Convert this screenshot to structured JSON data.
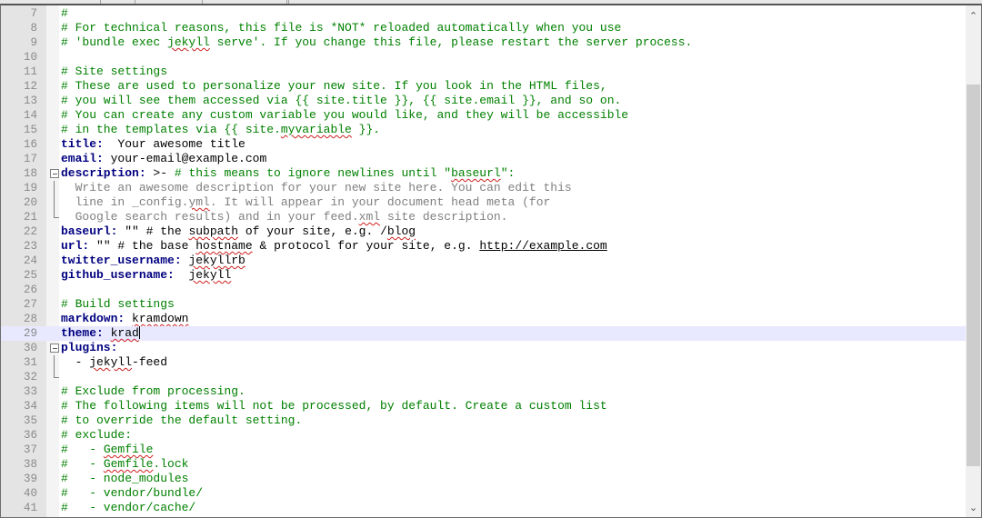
{
  "editor": {
    "current_line": 29,
    "colors": {
      "comment": "#008000",
      "key": "#000080",
      "folded_text": "#808080",
      "current_line_bg": "#e8e8ff",
      "misspelling": "#d02020"
    },
    "lines": [
      {
        "n": "7",
        "s": [
          [
            "c",
            "#"
          ]
        ]
      },
      {
        "n": "8",
        "s": [
          [
            "c",
            "# For technical reasons, this file is *NOT* reloaded automatically when you use"
          ]
        ]
      },
      {
        "n": "9",
        "s": [
          [
            "c",
            "# 'bundle exec "
          ],
          [
            "c sp",
            "jekyll"
          ],
          [
            "c",
            " serve'. If you change this file, please restart the server process."
          ]
        ]
      },
      {
        "n": "10",
        "s": []
      },
      {
        "n": "11",
        "s": [
          [
            "c",
            "# Site settings"
          ]
        ]
      },
      {
        "n": "12",
        "s": [
          [
            "c",
            "# These are used to personalize your new site. If you look in the HTML files,"
          ]
        ]
      },
      {
        "n": "13",
        "s": [
          [
            "c",
            "# you will see them accessed via {{ site.title }}, {{ site.email }}, and so on."
          ]
        ]
      },
      {
        "n": "14",
        "s": [
          [
            "c",
            "# You can create any custom variable you would like, and they will be accessible"
          ]
        ]
      },
      {
        "n": "15",
        "s": [
          [
            "c",
            "# in the templates via {{ site."
          ],
          [
            "c sp",
            "myvariable"
          ],
          [
            "c",
            " }}."
          ]
        ]
      },
      {
        "n": "16",
        "s": [
          [
            "k",
            "title:"
          ],
          [
            "",
            "  Your awesome title"
          ]
        ]
      },
      {
        "n": "17",
        "s": [
          [
            "k",
            "email:"
          ],
          [
            "",
            " your-email@example.com"
          ]
        ]
      },
      {
        "n": "18",
        "fold": "start",
        "s": [
          [
            "k",
            "description:"
          ],
          [
            "",
            " >- "
          ],
          [
            "c",
            "# this means to ignore newlines until \""
          ],
          [
            "c sp",
            "baseurl"
          ],
          [
            "c",
            "\":"
          ]
        ]
      },
      {
        "n": "19",
        "fold": "mid",
        "s": [
          [
            "g",
            "  Write an awesome description for your new site here. You can edit this"
          ]
        ]
      },
      {
        "n": "20",
        "fold": "mid",
        "s": [
          [
            "g",
            "  line in _config."
          ],
          [
            "g sp",
            "yml"
          ],
          [
            "g",
            ". It will appear in your document head meta (for"
          ]
        ]
      },
      {
        "n": "21",
        "fold": "end",
        "s": [
          [
            "g",
            "  Google search results) and in your feed."
          ],
          [
            "g sp",
            "xml"
          ],
          [
            "g",
            " site description."
          ]
        ]
      },
      {
        "n": "22",
        "s": [
          [
            "k",
            "baseurl:"
          ],
          [
            "",
            " \"\" # the "
          ],
          [
            "sp",
            "subpath"
          ],
          [
            "",
            " of your site, e.g. /"
          ],
          [
            "sp",
            "blog"
          ]
        ]
      },
      {
        "n": "23",
        "s": [
          [
            "k",
            "url:"
          ],
          [
            "",
            " \"\" # the base "
          ],
          [
            "sp",
            "hostname"
          ],
          [
            "",
            " & protocol for your site, e.g. "
          ],
          [
            "lnk",
            "http://example.com"
          ]
        ]
      },
      {
        "n": "24",
        "s": [
          [
            "k",
            "twitter_username:"
          ],
          [
            "",
            " "
          ],
          [
            "sp",
            "jekyllrb"
          ]
        ]
      },
      {
        "n": "25",
        "s": [
          [
            "k",
            "github_username:"
          ],
          [
            "",
            "  "
          ],
          [
            "sp",
            "jekyll"
          ]
        ]
      },
      {
        "n": "26",
        "s": []
      },
      {
        "n": "27",
        "s": [
          [
            "c",
            "# Build settings"
          ]
        ]
      },
      {
        "n": "28",
        "s": [
          [
            "k",
            "markdown:"
          ],
          [
            "",
            " "
          ],
          [
            "sp",
            "kramdown"
          ]
        ]
      },
      {
        "n": "29",
        "cur": true,
        "s": [
          [
            "k",
            "theme:"
          ],
          [
            "",
            " "
          ],
          [
            "sp",
            "krad"
          ]
        ]
      },
      {
        "n": "30",
        "fold": "start",
        "s": [
          [
            "k",
            "plugins:"
          ]
        ]
      },
      {
        "n": "31",
        "fold": "mid",
        "s": [
          [
            "",
            "  - "
          ],
          [
            "sp",
            "jekyll"
          ],
          [
            "",
            "-feed"
          ]
        ]
      },
      {
        "n": "32",
        "fold": "end",
        "s": []
      },
      {
        "n": "33",
        "s": [
          [
            "c",
            "# Exclude from processing."
          ]
        ]
      },
      {
        "n": "34",
        "s": [
          [
            "c",
            "# The following items will not be processed, by default. Create a custom list"
          ]
        ]
      },
      {
        "n": "35",
        "s": [
          [
            "c",
            "# to override the default setting."
          ]
        ]
      },
      {
        "n": "36",
        "s": [
          [
            "c",
            "# exclude:"
          ]
        ]
      },
      {
        "n": "37",
        "s": [
          [
            "c",
            "#   - "
          ],
          [
            "c sp",
            "Gemfile"
          ]
        ]
      },
      {
        "n": "38",
        "s": [
          [
            "c",
            "#   - "
          ],
          [
            "c sp",
            "Gemfile"
          ],
          [
            "c",
            ".lock"
          ]
        ]
      },
      {
        "n": "39",
        "s": [
          [
            "c",
            "#   - node_modules"
          ]
        ]
      },
      {
        "n": "40",
        "s": [
          [
            "c",
            "#   - vendor/bundle/"
          ]
        ]
      },
      {
        "n": "41",
        "s": [
          [
            "c",
            "#   - vendor/cache/"
          ]
        ]
      }
    ]
  },
  "scrollbar": {
    "up_icon": "chevron-up-icon",
    "down_icon": "chevron-down-icon",
    "up_glyph": "⌃",
    "down_glyph": "⌄"
  }
}
